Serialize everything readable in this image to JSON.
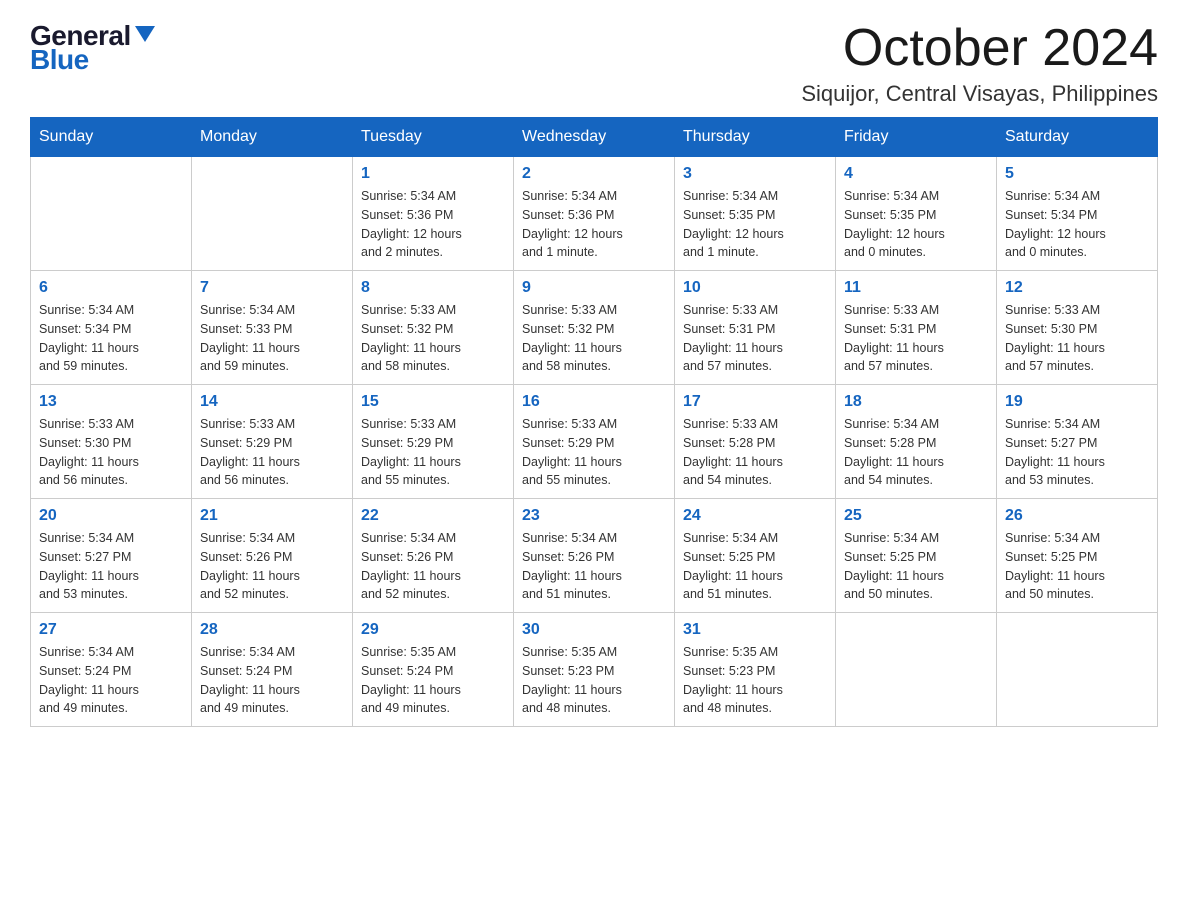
{
  "header": {
    "logo_general": "General",
    "logo_blue": "Blue",
    "month_title": "October 2024",
    "location": "Siquijor, Central Visayas, Philippines"
  },
  "days_of_week": [
    "Sunday",
    "Monday",
    "Tuesday",
    "Wednesday",
    "Thursday",
    "Friday",
    "Saturday"
  ],
  "weeks": [
    [
      {
        "day": "",
        "info": ""
      },
      {
        "day": "",
        "info": ""
      },
      {
        "day": "1",
        "info": "Sunrise: 5:34 AM\nSunset: 5:36 PM\nDaylight: 12 hours\nand 2 minutes."
      },
      {
        "day": "2",
        "info": "Sunrise: 5:34 AM\nSunset: 5:36 PM\nDaylight: 12 hours\nand 1 minute."
      },
      {
        "day": "3",
        "info": "Sunrise: 5:34 AM\nSunset: 5:35 PM\nDaylight: 12 hours\nand 1 minute."
      },
      {
        "day": "4",
        "info": "Sunrise: 5:34 AM\nSunset: 5:35 PM\nDaylight: 12 hours\nand 0 minutes."
      },
      {
        "day": "5",
        "info": "Sunrise: 5:34 AM\nSunset: 5:34 PM\nDaylight: 12 hours\nand 0 minutes."
      }
    ],
    [
      {
        "day": "6",
        "info": "Sunrise: 5:34 AM\nSunset: 5:34 PM\nDaylight: 11 hours\nand 59 minutes."
      },
      {
        "day": "7",
        "info": "Sunrise: 5:34 AM\nSunset: 5:33 PM\nDaylight: 11 hours\nand 59 minutes."
      },
      {
        "day": "8",
        "info": "Sunrise: 5:33 AM\nSunset: 5:32 PM\nDaylight: 11 hours\nand 58 minutes."
      },
      {
        "day": "9",
        "info": "Sunrise: 5:33 AM\nSunset: 5:32 PM\nDaylight: 11 hours\nand 58 minutes."
      },
      {
        "day": "10",
        "info": "Sunrise: 5:33 AM\nSunset: 5:31 PM\nDaylight: 11 hours\nand 57 minutes."
      },
      {
        "day": "11",
        "info": "Sunrise: 5:33 AM\nSunset: 5:31 PM\nDaylight: 11 hours\nand 57 minutes."
      },
      {
        "day": "12",
        "info": "Sunrise: 5:33 AM\nSunset: 5:30 PM\nDaylight: 11 hours\nand 57 minutes."
      }
    ],
    [
      {
        "day": "13",
        "info": "Sunrise: 5:33 AM\nSunset: 5:30 PM\nDaylight: 11 hours\nand 56 minutes."
      },
      {
        "day": "14",
        "info": "Sunrise: 5:33 AM\nSunset: 5:29 PM\nDaylight: 11 hours\nand 56 minutes."
      },
      {
        "day": "15",
        "info": "Sunrise: 5:33 AM\nSunset: 5:29 PM\nDaylight: 11 hours\nand 55 minutes."
      },
      {
        "day": "16",
        "info": "Sunrise: 5:33 AM\nSunset: 5:29 PM\nDaylight: 11 hours\nand 55 minutes."
      },
      {
        "day": "17",
        "info": "Sunrise: 5:33 AM\nSunset: 5:28 PM\nDaylight: 11 hours\nand 54 minutes."
      },
      {
        "day": "18",
        "info": "Sunrise: 5:34 AM\nSunset: 5:28 PM\nDaylight: 11 hours\nand 54 minutes."
      },
      {
        "day": "19",
        "info": "Sunrise: 5:34 AM\nSunset: 5:27 PM\nDaylight: 11 hours\nand 53 minutes."
      }
    ],
    [
      {
        "day": "20",
        "info": "Sunrise: 5:34 AM\nSunset: 5:27 PM\nDaylight: 11 hours\nand 53 minutes."
      },
      {
        "day": "21",
        "info": "Sunrise: 5:34 AM\nSunset: 5:26 PM\nDaylight: 11 hours\nand 52 minutes."
      },
      {
        "day": "22",
        "info": "Sunrise: 5:34 AM\nSunset: 5:26 PM\nDaylight: 11 hours\nand 52 minutes."
      },
      {
        "day": "23",
        "info": "Sunrise: 5:34 AM\nSunset: 5:26 PM\nDaylight: 11 hours\nand 51 minutes."
      },
      {
        "day": "24",
        "info": "Sunrise: 5:34 AM\nSunset: 5:25 PM\nDaylight: 11 hours\nand 51 minutes."
      },
      {
        "day": "25",
        "info": "Sunrise: 5:34 AM\nSunset: 5:25 PM\nDaylight: 11 hours\nand 50 minutes."
      },
      {
        "day": "26",
        "info": "Sunrise: 5:34 AM\nSunset: 5:25 PM\nDaylight: 11 hours\nand 50 minutes."
      }
    ],
    [
      {
        "day": "27",
        "info": "Sunrise: 5:34 AM\nSunset: 5:24 PM\nDaylight: 11 hours\nand 49 minutes."
      },
      {
        "day": "28",
        "info": "Sunrise: 5:34 AM\nSunset: 5:24 PM\nDaylight: 11 hours\nand 49 minutes."
      },
      {
        "day": "29",
        "info": "Sunrise: 5:35 AM\nSunset: 5:24 PM\nDaylight: 11 hours\nand 49 minutes."
      },
      {
        "day": "30",
        "info": "Sunrise: 5:35 AM\nSunset: 5:23 PM\nDaylight: 11 hours\nand 48 minutes."
      },
      {
        "day": "31",
        "info": "Sunrise: 5:35 AM\nSunset: 5:23 PM\nDaylight: 11 hours\nand 48 minutes."
      },
      {
        "day": "",
        "info": ""
      },
      {
        "day": "",
        "info": ""
      }
    ]
  ]
}
